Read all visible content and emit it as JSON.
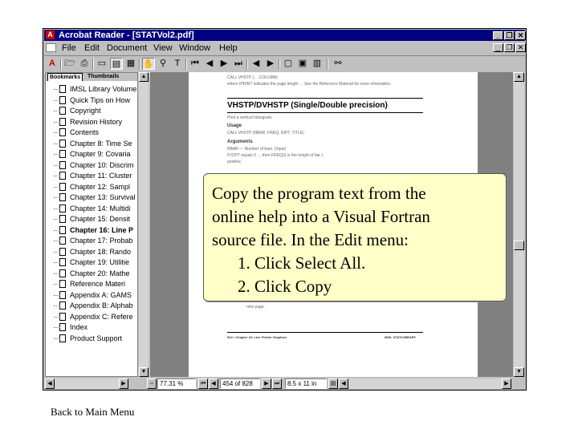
{
  "window": {
    "title": "Acrobat Reader - [STATVol2.pdf]",
    "app_icon": "acrobat-icon",
    "controls": [
      "_",
      "❐",
      "✕"
    ]
  },
  "menu": [
    "File",
    "Edit",
    "Document",
    "View",
    "Window",
    "Help"
  ],
  "toolbar": {
    "icons": [
      "acrobat-logo-icon",
      "open-icon",
      "print-icon",
      "page-only-icon",
      "bookmarks-pane-icon",
      "thumbnails-pane-icon",
      "hand-tool-icon",
      "zoom-tool-icon",
      "select-text-icon",
      "first-page-icon",
      "prev-page-icon",
      "next-page-icon",
      "last-page-icon",
      "go-back-icon",
      "go-forward-icon",
      "actual-size-icon",
      "fit-page-icon",
      "fit-width-icon",
      "find-icon"
    ]
  },
  "bookmarks": {
    "tabs": [
      "Bookmarks",
      "Thumbnails"
    ],
    "items": [
      "IMSL Library Volume",
      "Quick Tips on How",
      "Copyright",
      "Revision History",
      "Contents",
      "Chapter 8: Time Se",
      "Chapter 9: Covaria",
      "Chapter 10: Discrim",
      "Chapter 11: Cluster",
      "Chapter 12: Sampl",
      "Chapter 13: Survival",
      "Chapter 14: Multidi",
      "Chapter 15: Densit",
      "Chapter 16: Line P",
      "Chapter 17: Probab",
      "Chapter 18: Rando",
      "Chapter 19: Utilitie",
      "Chapter 20: Mathe",
      "Reference Materi",
      "Appendix A: GAMS",
      "Appendix B: Alphab",
      "Appendix C: Refere",
      "Index",
      "Product Support"
    ],
    "active_index": 13
  },
  "page": {
    "top_text_1": "CALL VHSTP (… COLUMN)",
    "top_text_2": "where IPRINT indicates the page length … See the Reference Material for more information.",
    "heading": "VHSTP/DVHSTP (Single/Double precision)",
    "subtitle": "Print a vertical histogram.",
    "usage_label": "Usage",
    "usage_text": "CALL VHSTP (NBAR, FREQ, IOPT, TITLE)",
    "arguments_label": "Arguments",
    "arg_text_1": "NBAR — Number of bars. (Input)",
    "arg_text_2": "If IOPT equals 0 … then FREQ(I) is the height of bar I.",
    "arg_text_3": "positive.",
    "bottom_text": "new page.",
    "footer_left": "924 • Chapter 16: Line Printer Graphics",
    "footer_right": "IMSL STAT/LIBRARY"
  },
  "status": {
    "zoom": "77.31 %",
    "page_count": "454 of 828",
    "page_size": "8.5 x 11 in"
  },
  "callout": {
    "lines": [
      "Copy the program text from the",
      "online help into a Visual Fortran",
      "source file. In the Edit menu:",
      "1. Click Select All.",
      "2. Click Copy"
    ]
  },
  "footer_link": "Back to Main Menu"
}
